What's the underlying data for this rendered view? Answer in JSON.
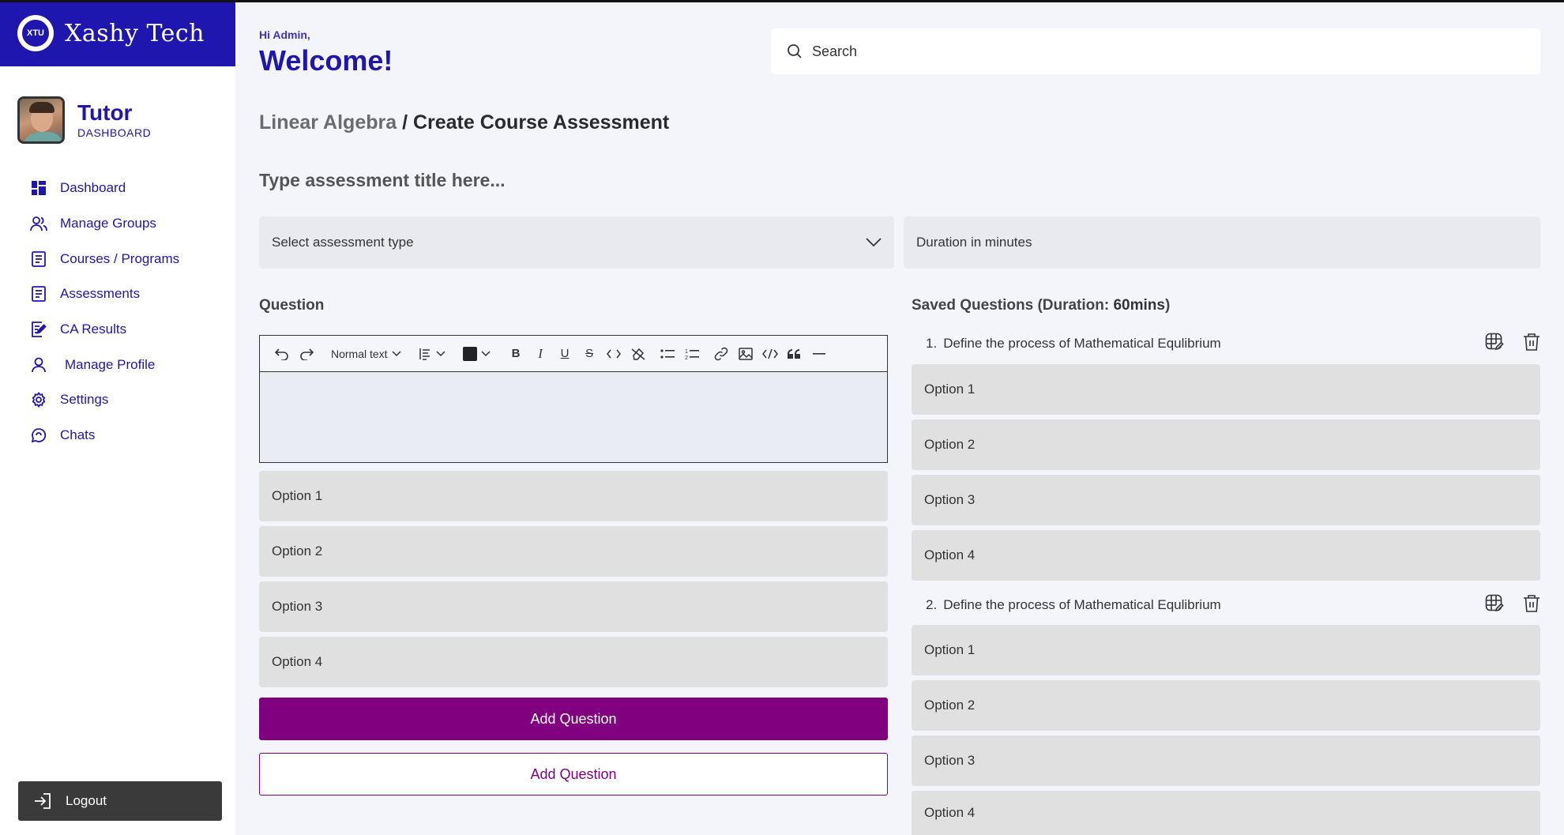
{
  "brand": {
    "name": "Xashy Tech",
    "logo_text": "XTU"
  },
  "profile": {
    "title": "Tutor",
    "subtitle": "DASHBOARD"
  },
  "sidebar": {
    "items": [
      {
        "label": "Dashboard",
        "icon": "dashboard-grid-icon"
      },
      {
        "label": "Manage Groups",
        "icon": "users-icon"
      },
      {
        "label": "Courses / Programs",
        "icon": "document-icon"
      },
      {
        "label": "Assessments",
        "icon": "document-icon"
      },
      {
        "label": "CA Results",
        "icon": "edit-document-icon"
      },
      {
        "label": "Manage Profile",
        "icon": "user-icon"
      },
      {
        "label": "Settings",
        "icon": "gear-icon"
      },
      {
        "label": "Chats",
        "icon": "chat-icon"
      }
    ],
    "logout_label": "Logout"
  },
  "header": {
    "greeting_small": "Hi Admin,",
    "greeting_big": "Welcome!",
    "search_placeholder": "Search"
  },
  "breadcrumb": {
    "parent": "Linear Algebra",
    "separator": " / ",
    "current": "Create Course Assessment"
  },
  "form": {
    "title_placeholder": "Type assessment title here...",
    "type_placeholder": "Select assessment type",
    "duration_placeholder": "Duration in minutes",
    "question_label": "Question",
    "toolbar": {
      "block_style": "Normal text"
    },
    "options": [
      "Option 1",
      "Option 2",
      "Option 3",
      "Option 4"
    ],
    "add_question_primary": "Add Question",
    "add_question_secondary": "Add Question"
  },
  "saved": {
    "label_prefix": "Saved Questions (Duration: ",
    "duration": "60mins",
    "label_suffix": ")",
    "questions": [
      {
        "number": "1.",
        "text": "Define the process of Mathematical Equlibrium",
        "options": [
          "Option 1",
          "Option 2",
          "Option 3",
          "Option 4"
        ]
      },
      {
        "number": "2.",
        "text": "Define the process of Mathematical Equlibrium",
        "options": [
          "Option 1",
          "Option 2",
          "Option 3",
          "Option 4"
        ]
      }
    ]
  },
  "colors": {
    "brand": "#1f16b0",
    "primary_button": "#800080",
    "sidebar_bg": "#ffffff",
    "page_bg": "#f3f5fb",
    "option_bg": "#e0e0e0"
  }
}
